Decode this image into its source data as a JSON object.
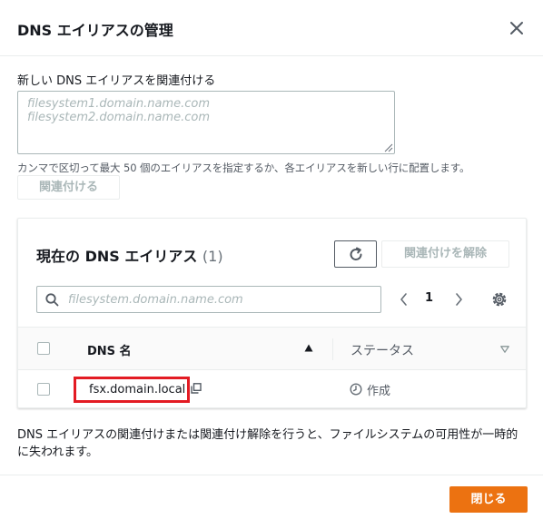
{
  "dialog": {
    "title": "DNS エイリアスの管理"
  },
  "new_alias": {
    "label": "新しい DNS エイリアスを関連付ける",
    "placeholder": "filesystem1.domain.name.com filesystem2.domain.name.com",
    "hint": "カンマで区切って最大 50 個のエイリアスを指定するか、各エイリアスを新しい行に配置します。",
    "associate_label": "関連付ける"
  },
  "current": {
    "title": "現在の DNS エイリアス",
    "count": "(1)",
    "disassociate_label": "関連付けを解除",
    "search_placeholder": "filesystem.domain.name.com",
    "page": "1",
    "columns": {
      "name": "DNS 名",
      "status": "ステータス"
    },
    "rows": [
      {
        "name": "fsx.domain.local",
        "status": "作成"
      }
    ]
  },
  "notice": "DNS エイリアスの関連付けまたは関連付け解除を行うと、ファイルシステムの可用性が一時的に失われます。",
  "footer": {
    "close_label": "閉じる"
  },
  "colors": {
    "primary": "#ec7211",
    "highlight": "#e31b23",
    "border": "#aab7b8",
    "text": "#16191f"
  },
  "icons": [
    "close-icon",
    "refresh-icon",
    "search-icon",
    "chevron-left-icon",
    "chevron-right-icon",
    "gear-icon",
    "sort-ascending-icon",
    "sort-icon",
    "copy-icon",
    "clock-icon"
  ]
}
